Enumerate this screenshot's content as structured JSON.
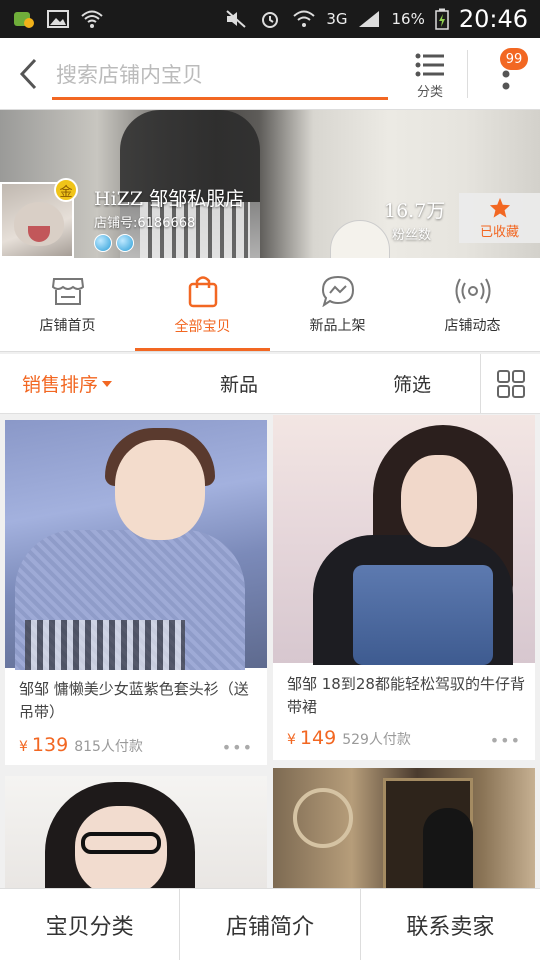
{
  "status_bar": {
    "battery_percent": "16%",
    "network": "3G",
    "time": "20:46",
    "icons": [
      "app-notification-icon",
      "image-icon",
      "wifi-icon",
      "mute-icon",
      "alarm-icon",
      "signal-icon",
      "battery-charging-icon"
    ]
  },
  "topbar": {
    "search_placeholder": "搜索店铺内宝贝",
    "category_label": "分类",
    "badge_count": "99"
  },
  "shop": {
    "name": "HiZZ 邹邹私服店",
    "id_label": "店铺号:6186668",
    "gold_badge": "金",
    "fans_count": "16.7万",
    "fans_label": "粉丝数",
    "favorite_label": "已收藏"
  },
  "nav_tabs": [
    {
      "label": "店铺首页",
      "icon": "storefront-icon",
      "active": false
    },
    {
      "label": "全部宝贝",
      "icon": "shopping-bag-icon",
      "active": true
    },
    {
      "label": "新品上架",
      "icon": "chat-bubble-icon",
      "active": false
    },
    {
      "label": "店铺动态",
      "icon": "broadcast-icon",
      "active": false
    }
  ],
  "sort_bar": {
    "sales_sort": "销售排序",
    "new": "新品",
    "filter": "筛选",
    "grid_toggle_icon": "grid-view-icon"
  },
  "products": [
    {
      "title": "邹邹 慵懒美少女蓝紫色套头衫（送吊带）",
      "price": "139",
      "currency": "¥",
      "sold": "815人付款"
    },
    {
      "title": "邹邹 18到28都能轻松驾驭的牛仔背带裙",
      "price": "149",
      "currency": "¥",
      "sold": "529人付款"
    },
    {
      "title": "",
      "price": "",
      "currency": "",
      "sold": ""
    },
    {
      "title": "",
      "price": "",
      "currency": "",
      "sold": ""
    }
  ],
  "bottom_bar": {
    "category": "宝贝分类",
    "intro": "店铺简介",
    "contact": "联系卖家"
  },
  "colors": {
    "accent": "#f26722",
    "status_bar": "#1a1a1a"
  }
}
